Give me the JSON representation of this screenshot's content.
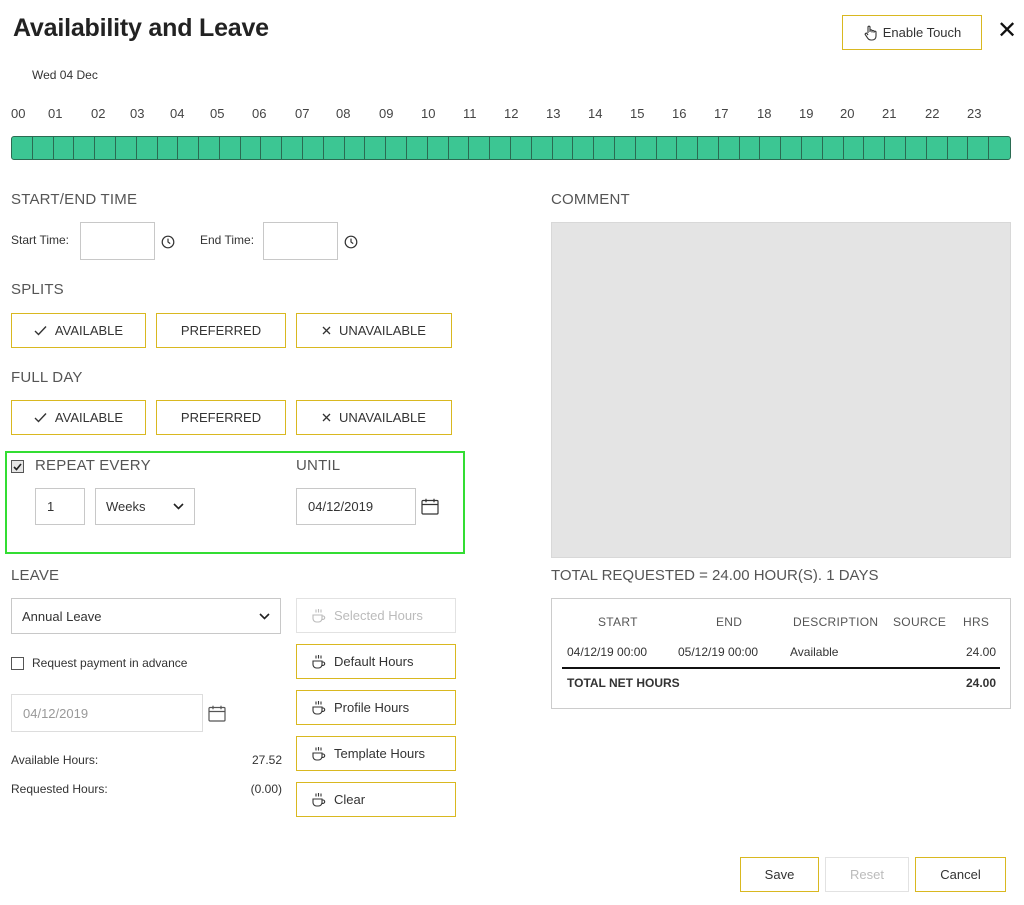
{
  "header": {
    "title": "Availability and Leave",
    "enable_touch_label": "Enable Touch",
    "date_label": "Wed 04 Dec"
  },
  "timeline": {
    "hours": [
      "00",
      "01",
      "02",
      "03",
      "04",
      "05",
      "06",
      "07",
      "08",
      "09",
      "10",
      "11",
      "12",
      "13",
      "14",
      "15",
      "16",
      "17",
      "18",
      "19",
      "20",
      "21",
      "22",
      "23"
    ],
    "fill_color": "#3cc693"
  },
  "start_end": {
    "heading": "START/END TIME",
    "start_label": "Start Time:",
    "start_value": "",
    "end_label": "End Time:",
    "end_value": ""
  },
  "splits": {
    "heading": "SPLITS",
    "available": "AVAILABLE",
    "preferred": "PREFERRED",
    "unavailable": "UNAVAILABLE"
  },
  "full_day": {
    "heading": "FULL DAY",
    "available": "AVAILABLE",
    "preferred": "PREFERRED",
    "unavailable": "UNAVAILABLE"
  },
  "repeat": {
    "checked": true,
    "heading": "REPEAT EVERY",
    "count": "1",
    "unit": "Weeks",
    "until_heading": "UNTIL",
    "until_date": "04/12/2019"
  },
  "leave": {
    "heading": "LEAVE",
    "type": "Annual Leave",
    "request_payment_label": "Request payment in advance",
    "request_payment_checked": false,
    "payment_date": "04/12/2019",
    "available_hours_label": "Available Hours:",
    "available_hours_value": "27.52",
    "requested_hours_label": "Requested Hours:",
    "requested_hours_value": "(0.00)",
    "buttons": {
      "selected_hours": "Selected Hours",
      "default_hours": "Default Hours",
      "profile_hours": "Profile Hours",
      "template_hours": "Template Hours",
      "clear": "Clear"
    }
  },
  "comment": {
    "heading": "COMMENT",
    "value": ""
  },
  "summary": {
    "total_requested": "TOTAL REQUESTED = 24.00 HOUR(S). 1 DAYS",
    "columns": [
      "START",
      "END",
      "DESCRIPTION",
      "SOURCE",
      "HRS"
    ],
    "row": {
      "start": "04/12/19 00:00",
      "end": "05/12/19 00:00",
      "description": "Available",
      "source": "",
      "hrs": "24.00"
    },
    "total_label": "TOTAL NET HOURS",
    "total_value": "24.00"
  },
  "footer": {
    "save": "Save",
    "reset": "Reset",
    "cancel": "Cancel"
  },
  "colors": {
    "accent_border": "#d9b820",
    "timeline_green": "#3cc693",
    "highlight_frame": "#33dd33"
  }
}
